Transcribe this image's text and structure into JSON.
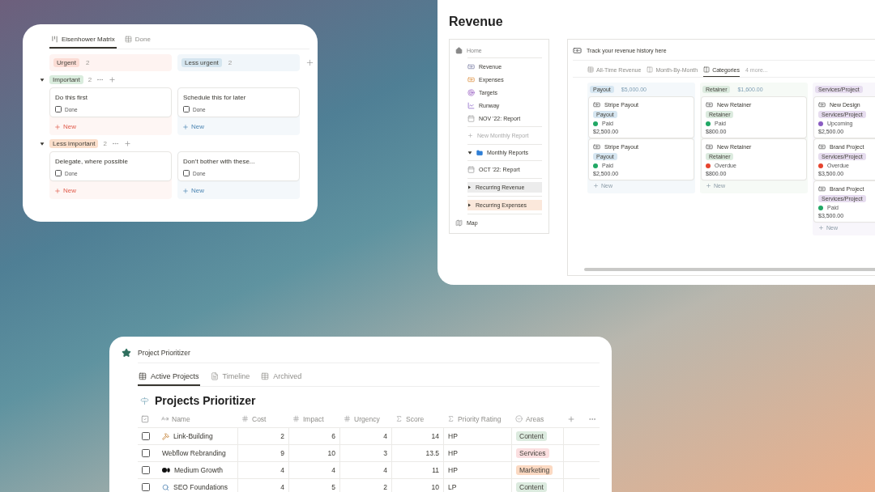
{
  "matrix": {
    "tabs": [
      {
        "label": "Eisenhower Matrix",
        "selected": true
      },
      {
        "label": "Done",
        "selected": false
      }
    ],
    "columns": [
      {
        "label": "Urgent",
        "count": "2",
        "color": "#fbdcd5"
      },
      {
        "label": "Less urgent",
        "count": "2",
        "color": "#d5e5ef"
      }
    ],
    "groups": [
      {
        "label": "Important",
        "count": "2",
        "color": "#d9ecdd",
        "expanded": true,
        "cells": [
          {
            "title": "Do this first",
            "check_label": "Done",
            "checked": false,
            "new_label": "New"
          },
          {
            "title": "Schedule this for later",
            "check_label": "Done",
            "checked": false,
            "new_label": "New"
          }
        ]
      },
      {
        "label": "Less important",
        "count": "2",
        "color": "#fbdfcb",
        "expanded": true,
        "cells": [
          {
            "title": "Delegate, where possible",
            "check_label": "Done",
            "checked": false,
            "new_label": "New"
          },
          {
            "title": "Don’t bother with these...",
            "check_label": "Done",
            "checked": false,
            "new_label": "New"
          }
        ]
      }
    ]
  },
  "revenue": {
    "title": "Revenue",
    "nav": {
      "home": "Home",
      "items": [
        {
          "label": "Revenue"
        },
        {
          "label": "Expenses"
        },
        {
          "label": "Targets"
        },
        {
          "label": "Runway"
        },
        {
          "label": "NOV '22: Report"
        }
      ],
      "new_report": "New Monthly Report",
      "folders": [
        {
          "label": "Monthly Reports",
          "expanded": true,
          "children": [
            {
              "label": "OCT '22: Report"
            }
          ]
        }
      ],
      "toggles": [
        {
          "label": "Recurring Revenue",
          "expanded": false,
          "color": "#ececec"
        },
        {
          "label": "Recurring Expenses",
          "expanded": false,
          "color": "#fbe8db"
        }
      ],
      "map": "Map"
    },
    "board": {
      "heading": "Track your revenue history here",
      "tabs": [
        {
          "label": "All-Time Revenue",
          "selected": false
        },
        {
          "label": "Month-By-Month",
          "selected": false
        },
        {
          "label": "Categories",
          "selected": true
        }
      ],
      "more_views": "4 more...",
      "columns": [
        {
          "label": "Payout",
          "total": "$5,000.00",
          "color": "#d6e6f1",
          "new_label": "New",
          "cards": [
            {
              "title": "Stripe Payout",
              "tag": "Payout",
              "status": "Paid",
              "color": "#21a865",
              "amount": "$2,500.00"
            },
            {
              "title": "Stripe Payout",
              "tag": "Payout",
              "status": "Paid",
              "color": "#21a865",
              "amount": "$2,500.00"
            }
          ]
        },
        {
          "label": "Retainer",
          "total": "$1,600.00",
          "color": "#dcebdf",
          "new_label": "New",
          "cards": [
            {
              "title": "New Retainer",
              "tag": "Retainer",
              "status": "Paid",
              "color": "#21a865",
              "amount": "$800.00"
            },
            {
              "title": "New Retainer",
              "tag": "Retainer",
              "status": "Overdue",
              "color": "#e6442e",
              "amount": "$800.00"
            }
          ]
        },
        {
          "label": "Services/Project",
          "color": "#e6dcef",
          "new_label": "New",
          "cards": [
            {
              "title": "New Design",
              "tag": "Services/Project",
              "status": "Upcoming",
              "color": "#8a5cc2",
              "amount": "$2,500.00"
            },
            {
              "title": "Brand Project",
              "tag": "Services/Project",
              "status": "Overdue",
              "color": "#e6442e",
              "amount": "$3,500.00"
            },
            {
              "title": "Brand Project",
              "tag": "Services/Project",
              "status": "Paid",
              "color": "#21a865",
              "amount": "$3,500.00"
            }
          ]
        }
      ]
    }
  },
  "projects": {
    "breadcrumb": "Project Prioritizer",
    "tabs": [
      {
        "label": "Active Projects",
        "selected": true
      },
      {
        "label": "Timeline",
        "selected": false
      },
      {
        "label": "Archived",
        "selected": false
      }
    ],
    "title": "Projects Prioritizer",
    "columns": [
      {
        "label": "Name",
        "kind": "text"
      },
      {
        "label": "Cost",
        "kind": "number"
      },
      {
        "label": "Impact",
        "kind": "number"
      },
      {
        "label": "Urgency",
        "kind": "number"
      },
      {
        "label": "Score",
        "kind": "formula"
      },
      {
        "label": "Priority Rating",
        "kind": "formula"
      },
      {
        "label": "Areas",
        "kind": "select"
      }
    ],
    "rows": [
      {
        "checked": false,
        "name": "Link-Building",
        "cost": "2",
        "impact": "6",
        "urgency": "4",
        "score": "14",
        "rating": "HP",
        "area": "Content",
        "color": "#dcebdf"
      },
      {
        "checked": false,
        "name": "Webflow Rebranding",
        "cost": "9",
        "impact": "10",
        "urgency": "3",
        "score": "13.5",
        "rating": "HP",
        "area": "Services",
        "color": "#fbdfe0"
      },
      {
        "checked": false,
        "name": "Medium Growth",
        "cost": "4",
        "impact": "4",
        "urgency": "4",
        "score": "11",
        "rating": "HP",
        "area": "Marketing",
        "color": "#fbd9c2"
      },
      {
        "checked": false,
        "name": "SEO Foundations",
        "cost": "4",
        "impact": "5",
        "urgency": "2",
        "score": "10",
        "rating": "LP",
        "area": "Content",
        "color": "#dcebdf"
      }
    ]
  }
}
